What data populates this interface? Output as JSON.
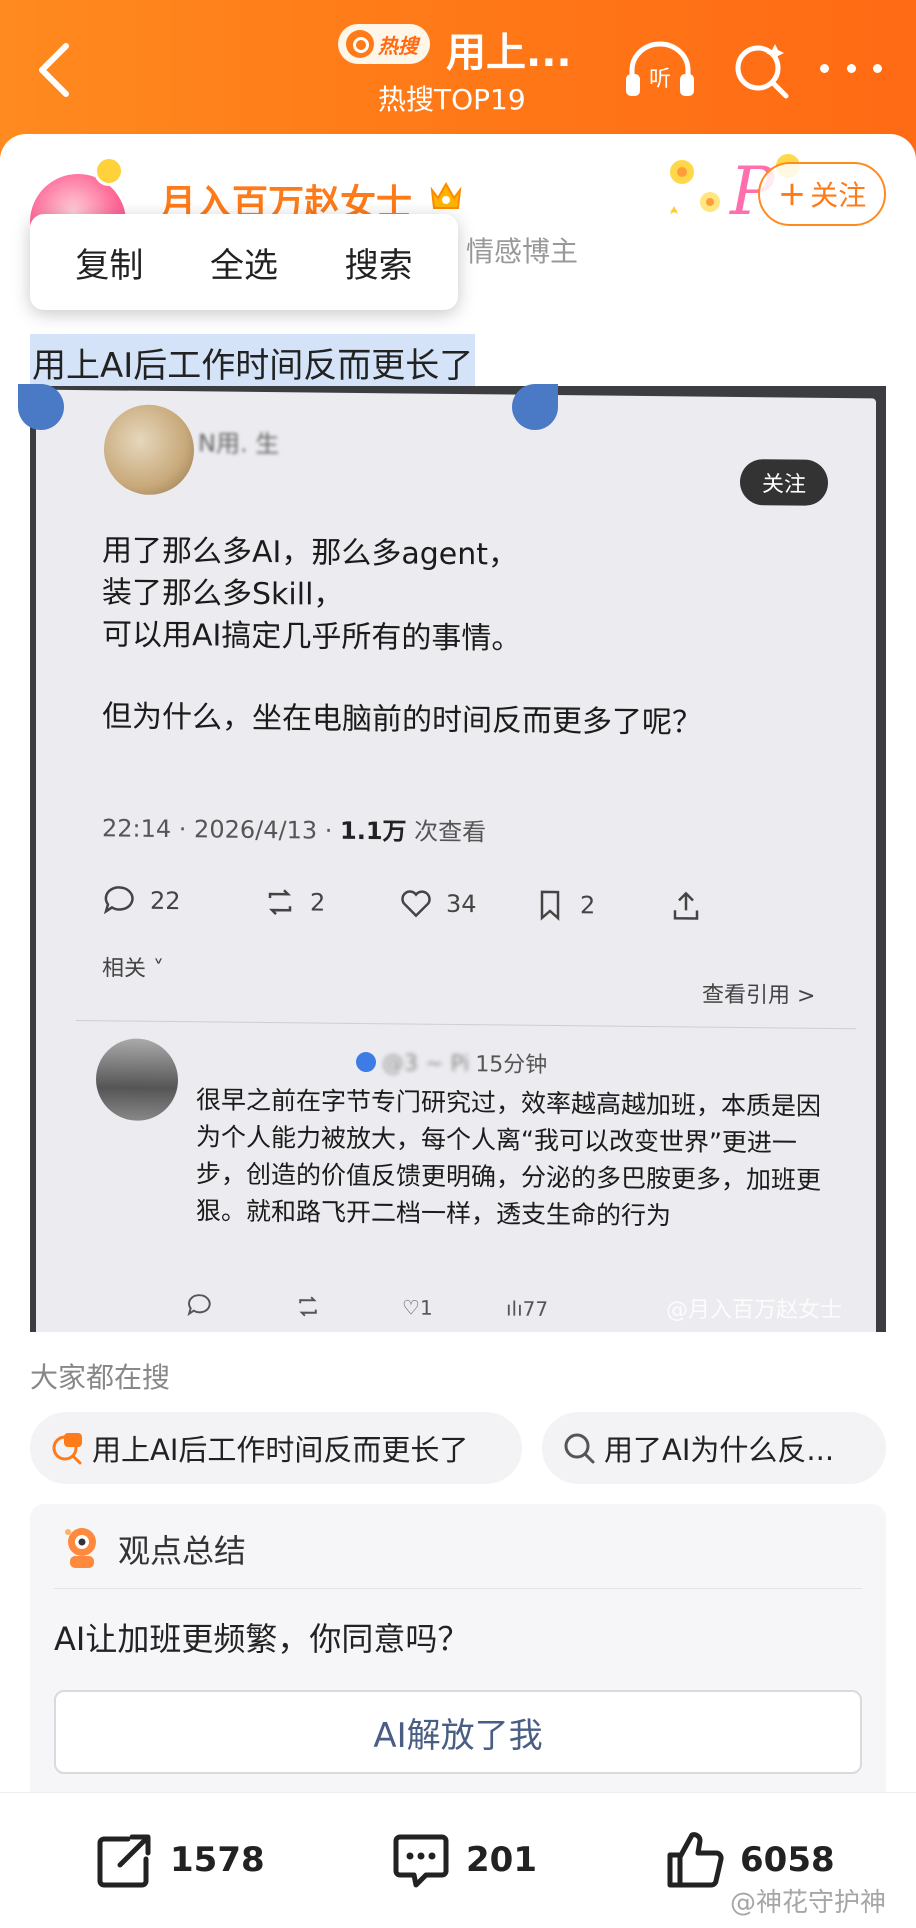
{
  "colors": {
    "brand": "#ff7a18",
    "selection": "#d4e3f7",
    "handle": "#4a7ac6",
    "option_text": "#4a5e85"
  },
  "header": {
    "hot_tag": "热搜",
    "title": "用上...",
    "subtitle": "热搜TOP19",
    "icons": [
      "back-icon",
      "listen-icon",
      "search-icon",
      "more-icon"
    ]
  },
  "author": {
    "name": "月入百万赵女士",
    "description": "情感博主",
    "follow_label": "关注",
    "follow_plus": "+"
  },
  "context_menu": {
    "items": [
      "复制",
      "全选",
      "搜索"
    ]
  },
  "post": {
    "title": "用上AI后工作时间反而更长了"
  },
  "photo": {
    "name_blurred": "N用. 生",
    "follow": "关注",
    "text_lines": [
      "用了那么多AI，那么多agent，",
      "装了那么多Skill，",
      "可以用AI搞定几乎所有的事情。",
      "但为什么，坐在电脑前的时间反而更多了呢？"
    ],
    "meta_time": "22:14 · 2026/4/13 · ",
    "meta_views": "1.1万",
    "meta_views_suffix": " 次查看",
    "actions": {
      "comments": "22",
      "reposts": "2",
      "likes": "34",
      "bookmarks": "2"
    },
    "related": "相关 ˅",
    "view_quotes": "查看引用 >",
    "reply_handle": "@3 ~ Pi",
    "reply_time": "15分钟",
    "reply_text": "很早之前在字节专门研究过，效率越高越加班，本质是因为个人能力被放大，每个人离“我可以改变世界”更进一步，创造的价值反馈更明确，分泌的多巴胺更多，加班更狠。就和路飞开二档一样，透支生命的行为",
    "reply_actions": {
      "likes": "1",
      "views": "77"
    },
    "watermark": "@月入百万赵女士"
  },
  "search_section": {
    "title": "大家都在搜",
    "chips": [
      "用上AI后工作时间反而更长了",
      "用了AI为什么反..."
    ]
  },
  "summary": {
    "title": "观点总结",
    "question": "AI让加班更频繁，你同意吗？",
    "options": [
      "AI解放了我"
    ]
  },
  "bottom_bar": {
    "share": "1578",
    "comments": "201",
    "likes": "6058"
  },
  "bottom_watermark": "@神花守护神"
}
